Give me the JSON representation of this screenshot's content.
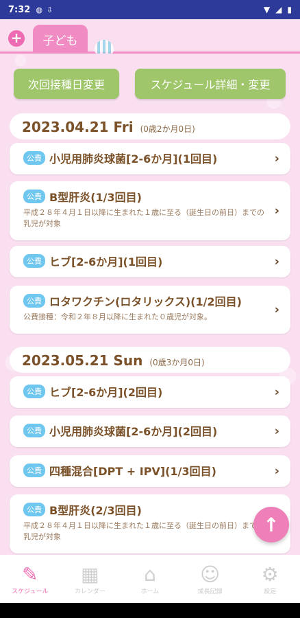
{
  "status_bar": {
    "time": "7:32"
  },
  "tabs": {
    "child_label": "子ども"
  },
  "actions": {
    "next_date_change": "次回接種日変更",
    "schedule_detail": "スケジュール詳細・変更"
  },
  "groups": [
    {
      "date": "2023.04.21 Fri",
      "age": "(0歳2か月0日)",
      "items": [
        {
          "badge": "公費",
          "name": "小児用肺炎球菌[2-6か月](1回目)",
          "note": ""
        },
        {
          "badge": "公費",
          "name": "B型肝炎(1/3回目)",
          "note": "平成２８年４月１日以降に生まれた１歳に至る（誕生日の前日）までの乳児が対象"
        },
        {
          "badge": "公費",
          "name": "ヒブ[2-6か月](1回目)",
          "note": ""
        },
        {
          "badge": "公費",
          "name": "ロタワクチン(ロタリックス)(1/2回目)",
          "note": "公費接種：令和２年８月以降に生まれた０歳児が対象。"
        }
      ]
    },
    {
      "date": "2023.05.21 Sun",
      "age": "(0歳3か月0日)",
      "items": [
        {
          "badge": "公費",
          "name": "ヒブ[2-6か月](2回目)",
          "note": ""
        },
        {
          "badge": "公費",
          "name": "小児用肺炎球菌[2-6か月](2回目)",
          "note": ""
        },
        {
          "badge": "公費",
          "name": "四種混合[DPT + IPV](1/3回目)",
          "note": ""
        },
        {
          "badge": "公費",
          "name": "B型肝炎(2/3回目)",
          "note": "平成２８年４月１日以降に生まれた１歳に至る（誕生日の前日）までの乳児が対象"
        }
      ]
    }
  ],
  "nav": [
    {
      "label": "スケジュール",
      "icon": "syringe-icon"
    },
    {
      "label": "カレンダー",
      "icon": "calendar-icon"
    },
    {
      "label": "ホーム",
      "icon": "home-icon"
    },
    {
      "label": "成長記録",
      "icon": "baby-face-icon"
    },
    {
      "label": "設定",
      "icon": "gear-icon"
    }
  ],
  "colors": {
    "accent_pink": "#ef7fb8",
    "button_green": "#9fc66a",
    "badge_blue": "#6fc6ee"
  }
}
